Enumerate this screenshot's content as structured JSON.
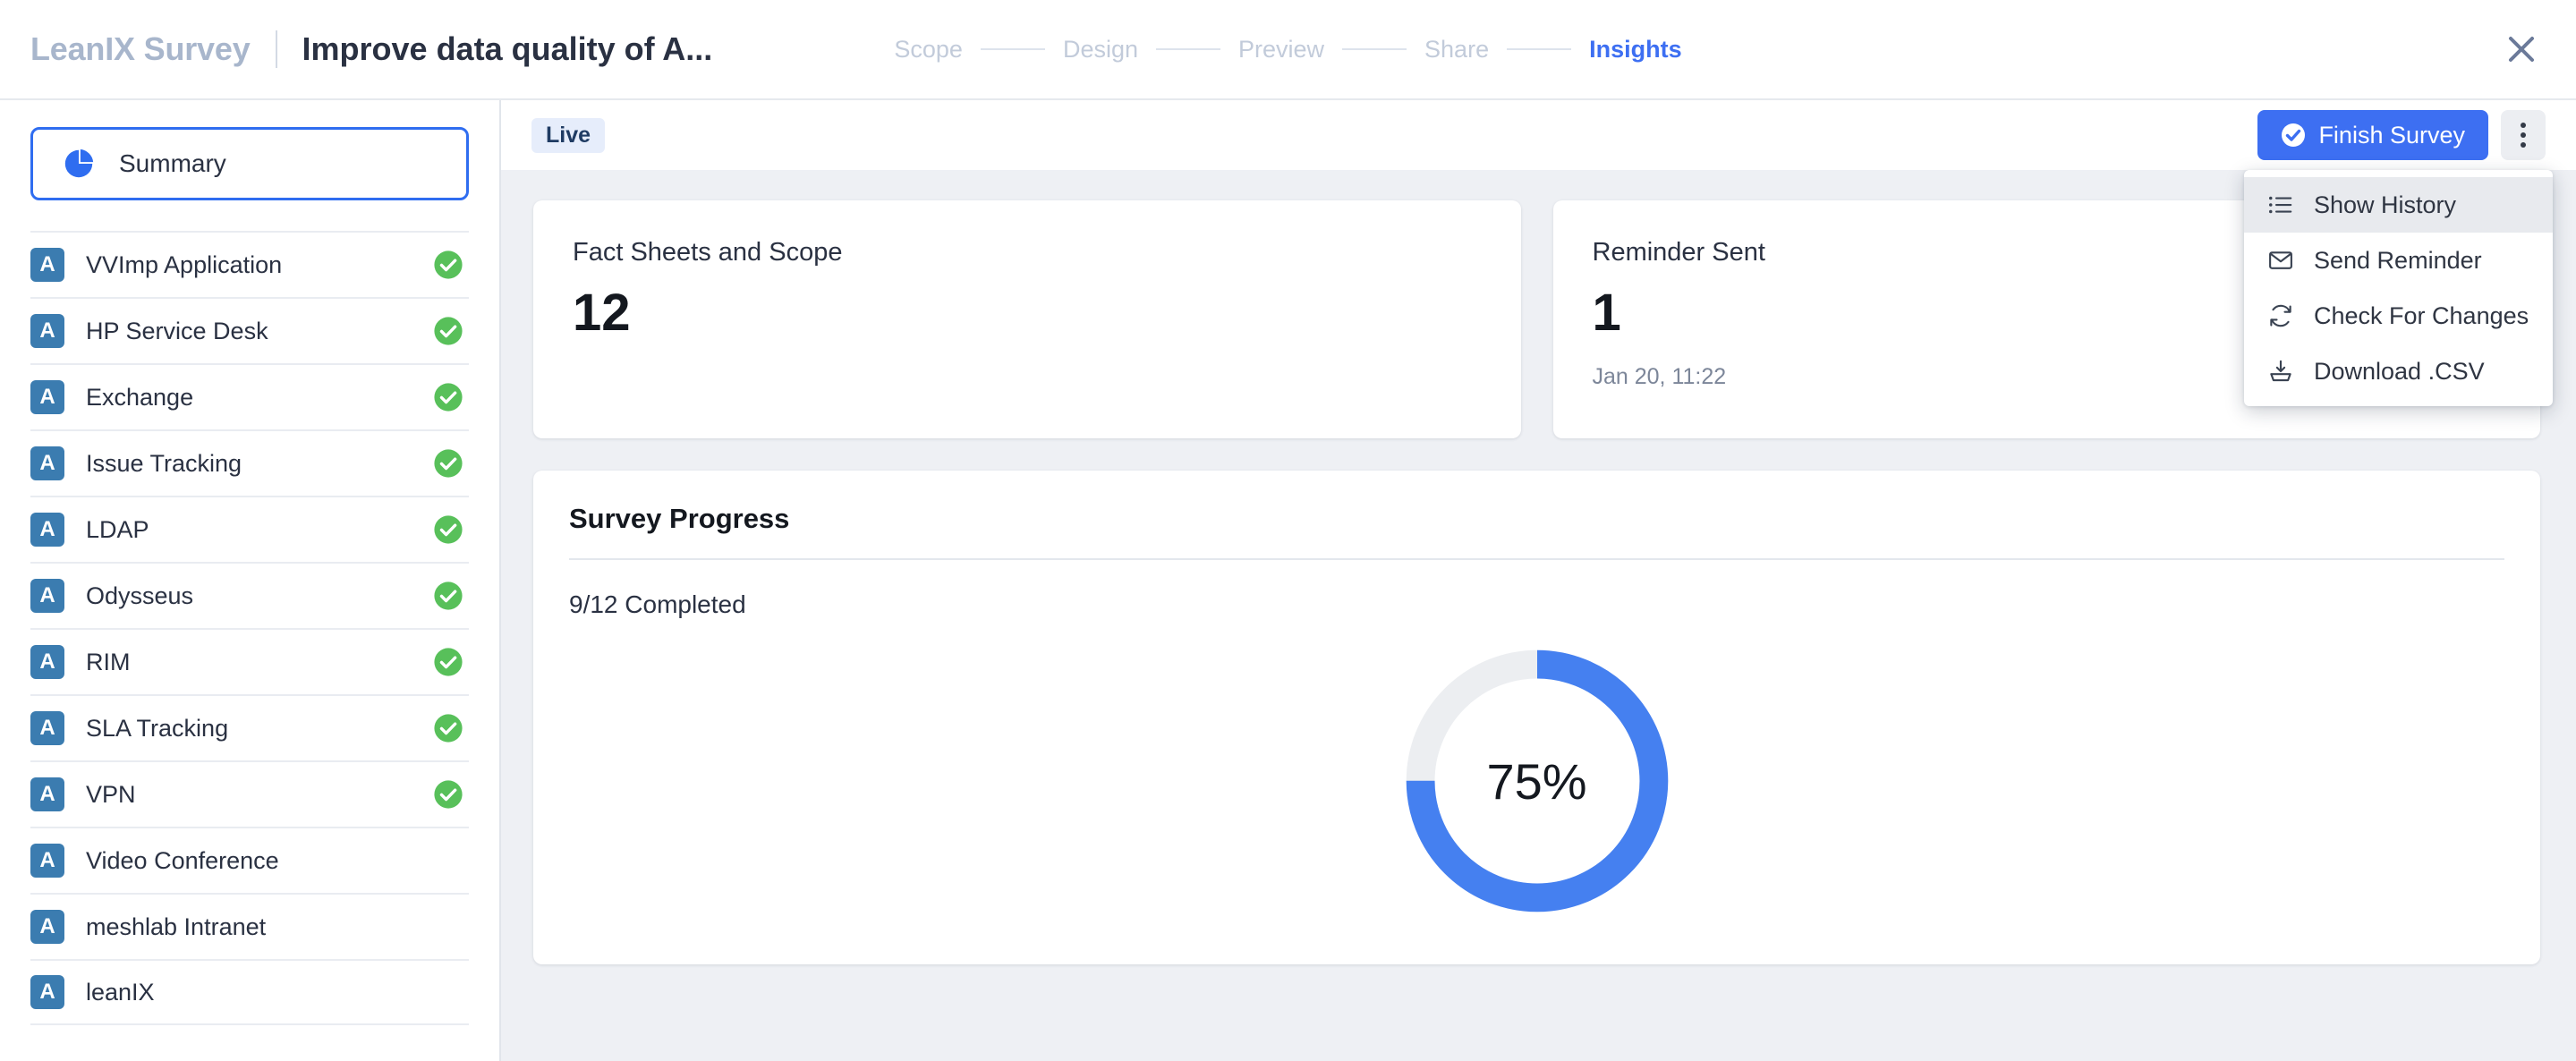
{
  "header": {
    "brand": "LeanIX Survey",
    "survey_title": "Improve data quality of A...",
    "close_icon": "close-icon",
    "steps": [
      {
        "label": "Scope",
        "active": false
      },
      {
        "label": "Design",
        "active": false
      },
      {
        "label": "Preview",
        "active": false
      },
      {
        "label": "Share",
        "active": false
      },
      {
        "label": "Insights",
        "active": true
      }
    ]
  },
  "sidebar": {
    "summary": {
      "label": "Summary",
      "icon": "pie-chart-icon",
      "selected": true
    },
    "items": [
      {
        "badge": "A",
        "label": "VVImp Application",
        "completed": true
      },
      {
        "badge": "A",
        "label": "HP Service Desk",
        "completed": true
      },
      {
        "badge": "A",
        "label": "Exchange",
        "completed": true
      },
      {
        "badge": "A",
        "label": "Issue Tracking",
        "completed": true
      },
      {
        "badge": "A",
        "label": "LDAP",
        "completed": true
      },
      {
        "badge": "A",
        "label": "Odysseus",
        "completed": true
      },
      {
        "badge": "A",
        "label": "RIM",
        "completed": true
      },
      {
        "badge": "A",
        "label": "SLA Tracking",
        "completed": true
      },
      {
        "badge": "A",
        "label": "VPN",
        "completed": true
      },
      {
        "badge": "A",
        "label": "Video Conference",
        "completed": false
      },
      {
        "badge": "A",
        "label": "meshlab Intranet",
        "completed": false
      },
      {
        "badge": "A",
        "label": "leanIX",
        "completed": false
      }
    ]
  },
  "toolbar": {
    "status_badge": "Live",
    "finish_label": "Finish Survey",
    "finish_icon": "check-circle-icon",
    "kebab_icon": "more-vertical-icon"
  },
  "dropdown": {
    "open": true,
    "items": [
      {
        "label": "Show History",
        "icon": "list-icon",
        "hovered": true
      },
      {
        "label": "Send Reminder",
        "icon": "envelope-icon",
        "hovered": false
      },
      {
        "label": "Check For Changes",
        "icon": "refresh-icon",
        "hovered": false
      },
      {
        "label": "Download .CSV",
        "icon": "download-icon",
        "hovered": false
      }
    ]
  },
  "cards": [
    {
      "title": "Fact Sheets and Scope",
      "value": "12",
      "sub": ""
    },
    {
      "title": "Reminder Sent",
      "value": "1",
      "sub": "Jan 20, 11:22"
    }
  ],
  "progress": {
    "title": "Survey Progress",
    "completed_text": "9/12 Completed",
    "percent_label": "75%"
  },
  "chart_data": {
    "type": "pie",
    "title": "Survey Progress",
    "categories": [
      "Completed",
      "Remaining"
    ],
    "values": [
      75,
      25
    ],
    "value_unit": "%",
    "completed_count": 9,
    "total_count": 12,
    "center_label": "75%",
    "colors": [
      "#4580f0",
      "#eceef1"
    ],
    "donut": true,
    "legend": "none",
    "start_angle_deg": 0
  },
  "colors": {
    "accent": "#3d6ff2",
    "chart_blue": "#4580f0",
    "chart_track": "#eceef1",
    "success_green": "#58c05a",
    "badge_blue": "#3b7cb0",
    "page_bg": "#eef0f4",
    "muted_text": "#7c8699"
  }
}
